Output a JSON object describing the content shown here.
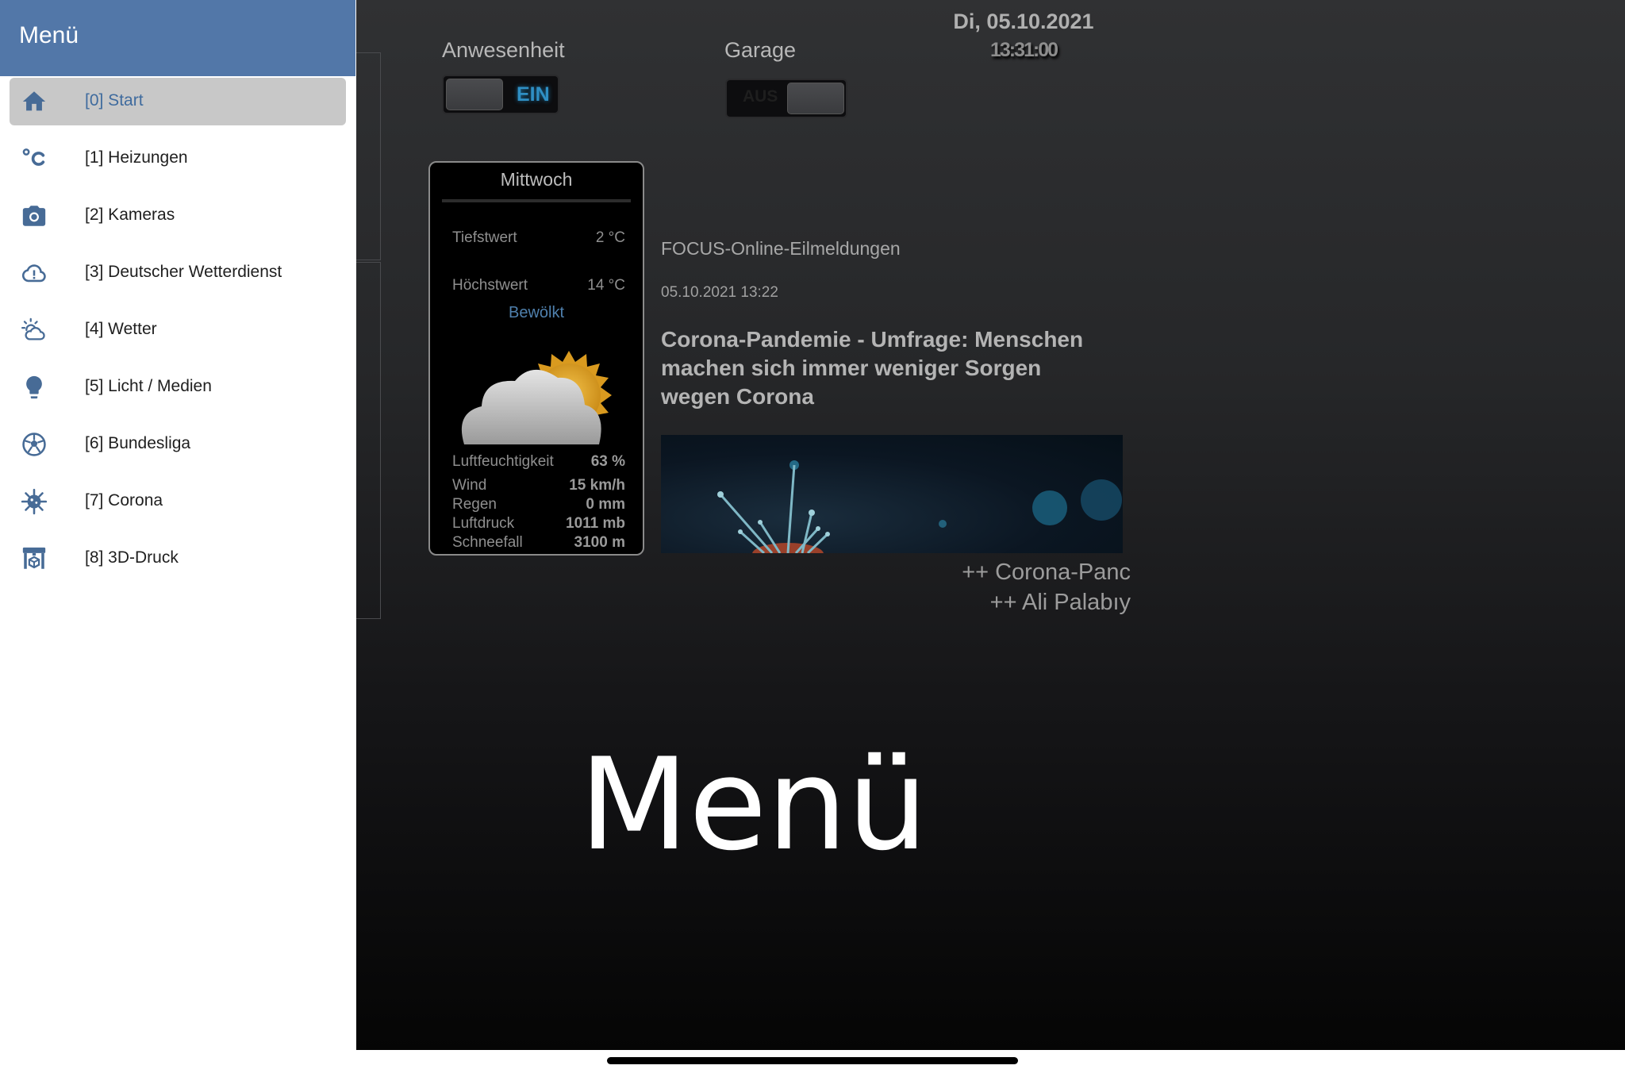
{
  "drawer": {
    "title": "Menü",
    "items": [
      {
        "label": "[0] Start",
        "icon": "home-icon",
        "active": true
      },
      {
        "label": "[1] Heizungen",
        "icon": "celsius-icon"
      },
      {
        "label": "[2] Kameras",
        "icon": "camera-icon"
      },
      {
        "label": "[3] Deutscher Wetterdienst",
        "icon": "cloud-alert-icon"
      },
      {
        "label": "[4] Wetter",
        "icon": "sun-cloud-icon"
      },
      {
        "label": "[5] Licht / Medien",
        "icon": "lightbulb-icon"
      },
      {
        "label": "[6] Bundesliga",
        "icon": "soccer-ball-icon"
      },
      {
        "label": "[7] Corona",
        "icon": "virus-icon"
      },
      {
        "label": "[8] 3D-Druck",
        "icon": "printer-3d-icon"
      }
    ]
  },
  "toggles": {
    "anwesenheit": {
      "label": "Anwesenheit",
      "state": "EIN"
    },
    "garage": {
      "label": "Garage",
      "state": "AUS"
    }
  },
  "datetime": {
    "date": "Di, 05.10.2021",
    "time": "13:31:00"
  },
  "weather": {
    "day": "Mittwoch",
    "min_label": "Tiefstwert",
    "min_value": "2 °C",
    "max_label": "Höchstwert",
    "max_value": "14 °C",
    "condition": "Bewölkt",
    "icon": "sun-behind-cloud-icon",
    "stats": [
      {
        "label": "Luftfeuchtigkeit",
        "value": "63 %"
      },
      {
        "label": "Wind",
        "value": "15 km/h"
      },
      {
        "label": "Regen",
        "value": "0 mm"
      },
      {
        "label": "Luftdruck",
        "value": "1011 mb"
      },
      {
        "label": "Schneefall",
        "value": "3100 m"
      }
    ]
  },
  "news": {
    "source": "FOCUS-Online-Eilmeldungen",
    "timestamp": "05.10.2021 13:22",
    "headline": "Corona-Pandemie - Umfrage: Menschen machen sich immer weniger Sorgen wegen Corona",
    "ticker": [
      "++ Corona-Panc",
      "++ Ali Palabıy"
    ]
  },
  "overlay_title": "Menü",
  "colors": {
    "accent": "#5277a8",
    "toggle_on": "#2f8fc4"
  }
}
